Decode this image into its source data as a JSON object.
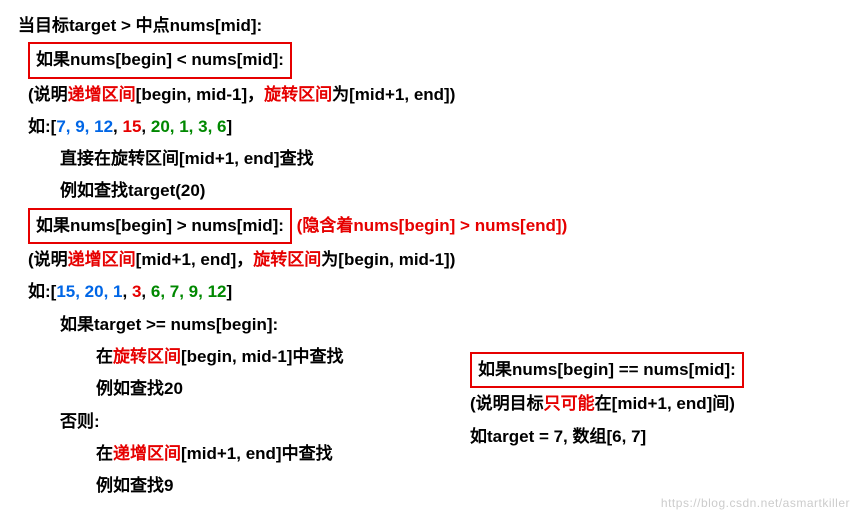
{
  "line1": {
    "text": "当目标target > 中点nums[mid]:"
  },
  "box1": {
    "text": "如果nums[begin] < nums[mid]:"
  },
  "line2": {
    "p1": "(说明",
    "p2": "递增区间",
    "p3": "[begin, mid-1]，",
    "p4": "旋转区间",
    "p5": "为[mid+1, end])"
  },
  "arr1": {
    "prefix": "如:[",
    "a": "7, 9, 12",
    "c1": ", ",
    "b": "15",
    "c2": ", ",
    "c": "20, 1, 3, 6",
    "suffix": "]"
  },
  "line3": "直接在旋转区间[mid+1, end]查找",
  "line4": "例如查找target(20)",
  "box2": {
    "text": "如果nums[begin] > nums[mid]:"
  },
  "box2_aside": {
    "p1": "(隐含着",
    "p2": "nums[begin] > nums[end]",
    "p3": ")"
  },
  "line5": {
    "p1": "(说明",
    "p2": "递增区间",
    "p3": "[mid+1, end]，",
    "p4": "旋转区间",
    "p5": "为[begin, mid-1])"
  },
  "arr2": {
    "prefix": "如:[",
    "a": "15, 20, 1",
    "c1": ", ",
    "b": "3",
    "c2": ", ",
    "c": "6, 7, 9, 12",
    "suffix": "]"
  },
  "line6": "如果target >= nums[begin]:",
  "line7": {
    "p1": "在",
    "p2": "旋转区间",
    "p3": "[begin, mid-1]中查找"
  },
  "line8": "例如查找20",
  "line9": "否则:",
  "line10": {
    "p1": "在",
    "p2": "递增区间",
    "p3": "[mid+1, end]中查找"
  },
  "line11": "例如查找9",
  "side": {
    "box": "如果nums[begin] == nums[mid]:",
    "l1a": "(说明目标",
    "l1b": "只可能",
    "l1c": "在[mid+1, end]间)",
    "l2": "如target = 7, 数组[6, 7]"
  },
  "watermark": "https://blog.csdn.net/asmartkiller"
}
